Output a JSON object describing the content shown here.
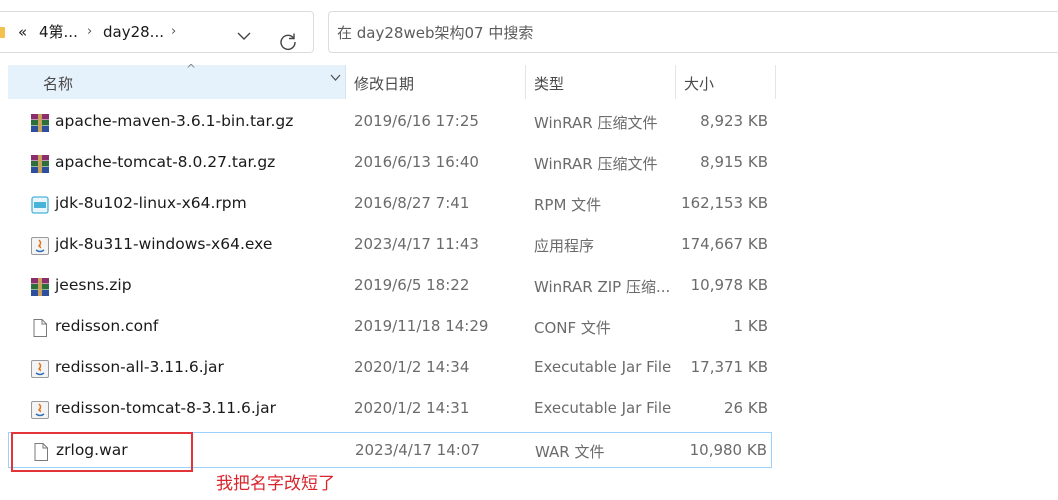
{
  "breadcrumb": {
    "back_glyph": "«",
    "items": [
      "4第...",
      "day28..."
    ],
    "separator": "›"
  },
  "search": {
    "placeholder": "在 day28web架构07 中搜索"
  },
  "columns": {
    "name": "名称",
    "date": "修改日期",
    "type": "类型",
    "size": "大小"
  },
  "files": [
    {
      "name": "apache-maven-3.6.1-bin.tar.gz",
      "date": "2019/6/16 17:25",
      "type": "WinRAR 压缩文件",
      "size": "8,923 KB",
      "icon": "winrar-archive-icon"
    },
    {
      "name": "apache-tomcat-8.0.27.tar.gz",
      "date": "2016/6/13 16:40",
      "type": "WinRAR 压缩文件",
      "size": "8,915 KB",
      "icon": "winrar-archive-icon"
    },
    {
      "name": "jdk-8u102-linux-x64.rpm",
      "date": "2016/8/27 7:41",
      "type": "RPM 文件",
      "size": "162,153 KB",
      "icon": "rpm-file-icon"
    },
    {
      "name": "jdk-8u311-windows-x64.exe",
      "date": "2023/4/17 11:43",
      "type": "应用程序",
      "size": "174,667 KB",
      "icon": "java-exe-icon"
    },
    {
      "name": "jeesns.zip",
      "date": "2019/6/5 18:22",
      "type": "WinRAR ZIP 压缩...",
      "size": "10,978 KB",
      "icon": "winrar-archive-icon"
    },
    {
      "name": "redisson.conf",
      "date": "2019/11/18 14:29",
      "type": "CONF 文件",
      "size": "1 KB",
      "icon": "blank-file-icon"
    },
    {
      "name": "redisson-all-3.11.6.jar",
      "date": "2020/1/2 14:34",
      "type": "Executable Jar File",
      "size": "17,371 KB",
      "icon": "java-jar-icon"
    },
    {
      "name": "redisson-tomcat-8-3.11.6.jar",
      "date": "2020/1/2 14:31",
      "type": "Executable Jar File",
      "size": "26 KB",
      "icon": "java-jar-icon"
    },
    {
      "name": "zrlog.war",
      "date": "2023/4/17 14:07",
      "type": "WAR 文件",
      "size": "10,980 KB",
      "icon": "blank-file-icon"
    }
  ],
  "annotation": "我把名字改短了",
  "colors": {
    "header_bg": "#e5f1fb",
    "selection_border": "#99d1ff",
    "annotation_red": "#e3343a"
  }
}
